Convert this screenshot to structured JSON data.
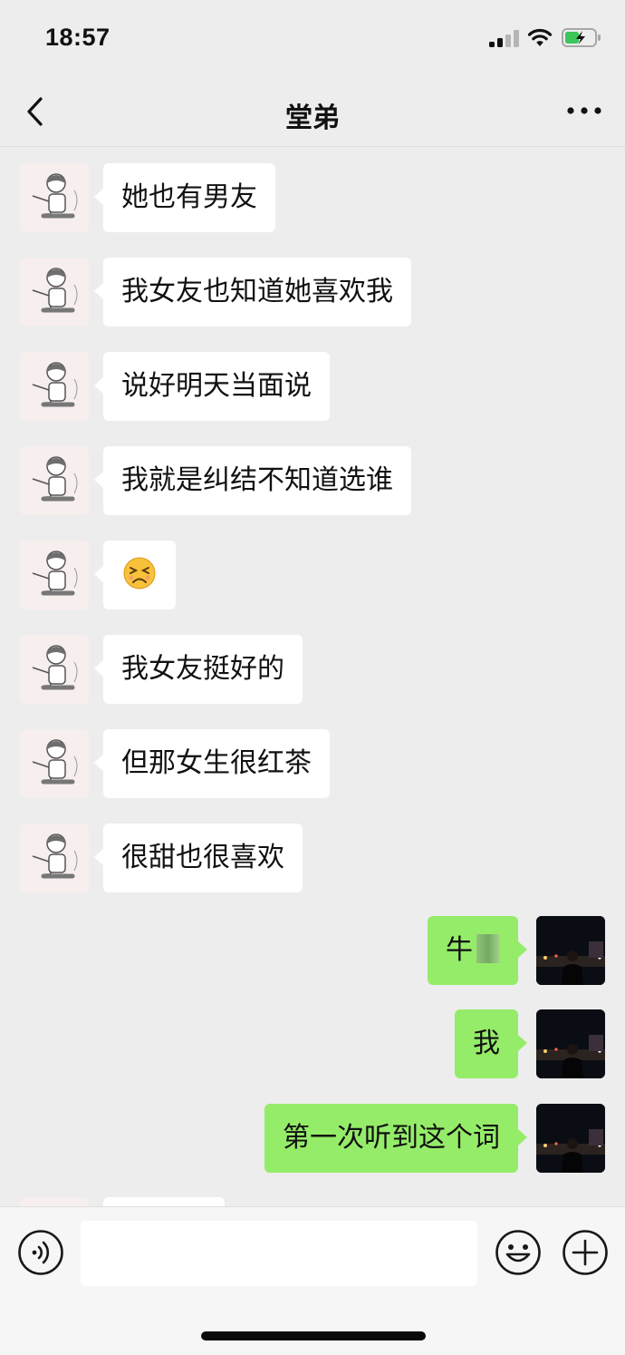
{
  "status_bar": {
    "time": "18:57"
  },
  "nav": {
    "title": "堂弟"
  },
  "messages": [
    {
      "from": "them",
      "text": "她也有男友"
    },
    {
      "from": "them",
      "text": "我女友也知道她喜欢我"
    },
    {
      "from": "them",
      "text": "说好明天当面说"
    },
    {
      "from": "them",
      "text": "我就是纠结不知道选谁"
    },
    {
      "from": "them",
      "emoji": "persevering-face-emoji"
    },
    {
      "from": "them",
      "text": "我女友挺好的"
    },
    {
      "from": "them",
      "text": "但那女生很红茶"
    },
    {
      "from": "them",
      "text": "很甜也很喜欢"
    },
    {
      "from": "me",
      "text": "牛"
    },
    {
      "from": "me",
      "text": "我"
    },
    {
      "from": "me",
      "text": "第一次听到这个词"
    }
  ],
  "input_bar": {
    "placeholder": ""
  },
  "colors": {
    "background": "#ededed",
    "bubble_them": "#ffffff",
    "bubble_me": "#95ec69",
    "input_bar": "#f6f6f6"
  }
}
